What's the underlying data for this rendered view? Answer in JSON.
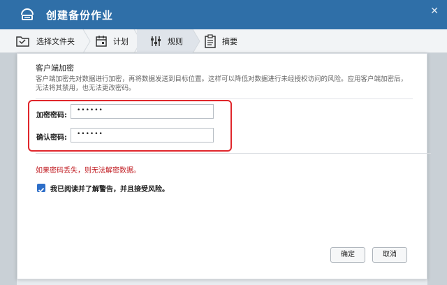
{
  "window": {
    "title": "创建备份作业"
  },
  "steps": [
    {
      "label": "选择文件夹",
      "icon": "folder-icon"
    },
    {
      "label": "计划",
      "icon": "calendar-icon"
    },
    {
      "label": "规则",
      "icon": "sliders-icon"
    },
    {
      "label": "摘要",
      "icon": "clipboard-icon"
    }
  ],
  "encryption": {
    "title": "客户端加密",
    "description": "客户端加密先对数据进行加密，再将数据发送到目标位置。这样可以降低对数据进行未经授权访问的风险。应用客户端加密后，无法将其禁用，也无法更改密码。",
    "password_label": "加密密码:",
    "password_value": "••••••",
    "confirm_label": "确认密码:",
    "confirm_value": "••••••"
  },
  "warning": "如果密码丢失，则无法解密数据。",
  "acknowledge": {
    "label": "我已阅读并了解警告，并且接受风险。",
    "checked": true
  },
  "buttons": {
    "ok": "确定",
    "cancel": "取消"
  },
  "colors": {
    "titlebar": "#2f6fa8",
    "warning": "#c0191f",
    "highlight": "#e0262b",
    "checkbox": "#2d6ec8"
  }
}
